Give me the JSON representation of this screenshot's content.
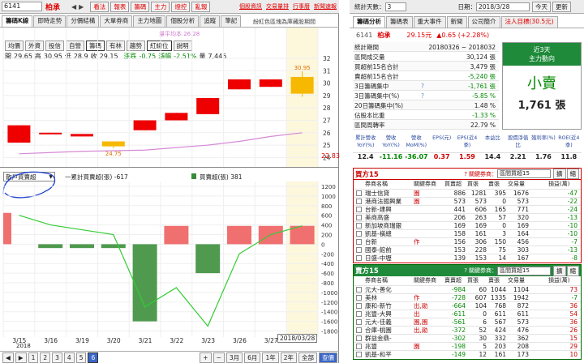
{
  "topbar": {
    "stock_code": "6141",
    "stock_name": "柏承",
    "links": [
      "看法",
      "報表",
      "籌碼",
      "主力",
      "燈控",
      "亂報"
    ],
    "right_links": [
      "個股資訊",
      "交易量排",
      "行事曆",
      "新聞速報"
    ]
  },
  "chart_tabs": [
    "籌碼K線",
    "即時走勢",
    "分價結構",
    "大單券商",
    "主力地圖",
    "個股分析",
    "追蹤",
    "筆記"
  ],
  "legend_note": "紛紅色區塊為庫藏股期間",
  "toolbar": [
    "均價",
    "外資",
    "投信",
    "自營",
    "籌碼",
    "有林",
    "趨勢",
    "紅線位",
    "說明"
  ],
  "ma_label": "量平均本 26.28",
  "ohlc": {
    "open_label": "開",
    "open": "29.65",
    "high_label": "高",
    "high": "30.95",
    "low_label": "低",
    "low": "28.9",
    "close_label": "收",
    "close": "29.15",
    "chg_label": "漲跌",
    "chg": "-0.75",
    "pct_label": "漲幅",
    "pct": "-2.51%",
    "vol_label": "量",
    "vol": "7,445"
  },
  "price_axis": [
    "32",
    "31",
    "30",
    "29",
    "28",
    "27",
    "26",
    "25",
    "24",
    "23",
    "22"
  ],
  "last_price_tag": "22.83",
  "high_tag": "30.95",
  "low_tag": "24.75",
  "lower_select": "散戶買賣超",
  "lower_legend1": "一累計買賣超(張) -617",
  "lower_legend2": "買賣超(張) 381",
  "lower_axis": [
    "1200",
    "1000",
    "800",
    "600",
    "400",
    "200",
    "0",
    "-200",
    "-400",
    "-600",
    "-800",
    "-1000",
    "-1200",
    "-1400",
    "-1600",
    "-1800"
  ],
  "dates": [
    "3/15",
    "3/16",
    "3/19",
    "3/20",
    "3/21",
    "3/22",
    "3/23",
    "3/26",
    "3/27"
  ],
  "year": "2018",
  "cursor_date": "2018/03/28",
  "bottom_nav": [
    "1",
    "2",
    "3",
    "4",
    "5",
    "6"
  ],
  "bottom_right": [
    "3月",
    "6月",
    "1年",
    "2年",
    "全部",
    "查價"
  ],
  "candles": [
    {
      "o": 25.2,
      "c": 26.6,
      "h": 26.6,
      "l": 25.2,
      "up": true
    },
    {
      "o": 25.9,
      "c": 26.0,
      "h": 26.0,
      "l": 25.9,
      "up": true
    },
    {
      "o": 25.7,
      "c": 25.9,
      "h": 25.9,
      "l": 25.7,
      "up": true
    },
    {
      "o": 25.3,
      "c": 24.9,
      "h": 25.3,
      "l": 24.75,
      "up": false
    },
    {
      "o": 26.2,
      "c": 27.0,
      "h": 27.0,
      "l": 26.2,
      "up": true
    },
    {
      "o": 27.0,
      "c": 27.6,
      "h": 27.6,
      "l": 27.0,
      "up": true
    },
    {
      "o": 28.8,
      "c": 27.5,
      "h": 28.8,
      "l": 27.5,
      "up": true
    },
    {
      "o": 29.5,
      "c": 30.3,
      "h": 30.3,
      "l": 29.5,
      "up": true
    },
    {
      "o": 29.7,
      "c": 30.3,
      "h": 30.3,
      "l": 29.7,
      "up": true
    },
    {
      "o": 30.5,
      "c": 29.15,
      "h": 30.95,
      "l": 28.9,
      "up": false
    }
  ],
  "ma_line": [
    24.3,
    24.4,
    24.5,
    24.55,
    24.6,
    24.8,
    25.0,
    25.3,
    25.7,
    26.0
  ],
  "net_bars": [
    650,
    -80,
    -80,
    -80,
    -1600,
    380,
    -600,
    380,
    380,
    381
  ],
  "cum_line": [
    600,
    400,
    300,
    200,
    -1300,
    -900,
    -1700,
    -200,
    200,
    381
  ],
  "right": {
    "days_label": "統計天數：",
    "days": "3",
    "date_label": "日期：",
    "date": "2018/3/28",
    "today_btn": "今天",
    "refresh_btn": "更新",
    "tabs": [
      "籌碼分析",
      "籌碼表",
      "重大事件",
      "新聞",
      "公司簡介",
      "法人目標(30.5元)"
    ],
    "code": "6141",
    "name": "柏承",
    "price": "29.15元",
    "change": "▲0.65 (+2.28%)",
    "stats": [
      {
        "k": "統計期間",
        "v": "20180326 ~ 2018032"
      },
      {
        "k": "區間成交量",
        "v": "30,124 張"
      },
      {
        "k": "買超前15名合計",
        "v": "3,479 張"
      },
      {
        "k": "賣超前15名合計",
        "v": "-5,240 張"
      },
      {
        "k": "3日籌碼集中",
        "v": "-1,761 張"
      },
      {
        "k": "3日籌碼集中(%)",
        "v": "-5.85 %"
      },
      {
        "k": "20日籌碼集中(%)",
        "v": "1.48 %"
      },
      {
        "k": "佔股本比重",
        "v": "-1.33 %"
      },
      {
        "k": "區間周轉率",
        "v": "22.79 %"
      }
    ],
    "panel_title1": "近3天",
    "panel_title2": "主力動向",
    "panel_status": "小賣",
    "panel_amount": "1,761 張",
    "kpi_heads": [
      "累計營收YoY(%)",
      "營收YoY(%)",
      "營收MoM(%)",
      "EPS(元)",
      "EPS(近4季)",
      "本益比",
      "股價淨值比",
      "殖利率(%)",
      "ROE(近4季)"
    ],
    "kpi_vals": [
      "12.4",
      "-11.16",
      "-36.07",
      "0.37",
      "1.59",
      "14.4",
      "2.21",
      "1.76",
      "11.8"
    ],
    "buy_title": "買方15",
    "sell_title": "賣方15",
    "related_label": "關鍵券商：",
    "related_select": "區間買超15",
    "zoom_btn": "擴",
    "toggle_btn": "縮",
    "col_heads_buy": [
      "券商名稱",
      "關鍵券商",
      "買賣超",
      "買張",
      "賣張",
      "交易量",
      "損益(萬)"
    ],
    "col_heads_sell": [
      "券商名稱",
      "關鍵券商",
      "賣賣超",
      "買張",
      "賣張",
      "交易量",
      "損益(萬)"
    ],
    "buy_rows": [
      [
        "瑞士信貸",
        "園",
        "886",
        "1281",
        "395",
        "1676",
        "-47"
      ],
      [
        "港商法國興業",
        "園",
        "573",
        "573",
        "0",
        "573",
        "-22"
      ],
      [
        "台新-建興",
        "",
        "441",
        "606",
        "165",
        "771",
        "-24"
      ],
      [
        "美商高盛",
        "",
        "206",
        "263",
        "57",
        "320",
        "-13"
      ],
      [
        "新加坡商瑞銀",
        "",
        "169",
        "169",
        "0",
        "169",
        "-10"
      ],
      [
        "凱基-橫總",
        "",
        "158",
        "161",
        "3",
        "164",
        "-10"
      ],
      [
        "台新",
        "作",
        "156",
        "306",
        "150",
        "456",
        "-7"
      ],
      [
        "國泰-館前",
        "",
        "153",
        "228",
        "75",
        "303",
        "-13"
      ],
      [
        "日盛-中壢",
        "",
        "139",
        "153",
        "14",
        "167",
        "-8"
      ]
    ],
    "sell_rows": [
      [
        "元大-善化",
        "",
        "-984",
        "60",
        "1044",
        "1104",
        "73"
      ],
      [
        "美林",
        "作",
        "-728",
        "607",
        "1335",
        "1942",
        "-7"
      ],
      [
        "康和-新竹",
        "出,勛",
        "-664",
        "104",
        "768",
        "872",
        "36"
      ],
      [
        "兆豐-大興",
        "出",
        "-611",
        "0",
        "611",
        "611",
        "54"
      ],
      [
        "元大-佳義",
        "園,園",
        "-561",
        "6",
        "567",
        "573",
        "36"
      ],
      [
        "合庫-桃園",
        "出,勛",
        "-372",
        "52",
        "424",
        "476",
        "26"
      ],
      [
        "群益金鼎-",
        "",
        "-302",
        "30",
        "332",
        "362",
        "15"
      ],
      [
        "兆豐",
        "園",
        "-198",
        "5",
        "203",
        "208",
        "29"
      ],
      [
        "凱基-和平",
        "",
        "-149",
        "12",
        "161",
        "173",
        "10"
      ]
    ]
  }
}
